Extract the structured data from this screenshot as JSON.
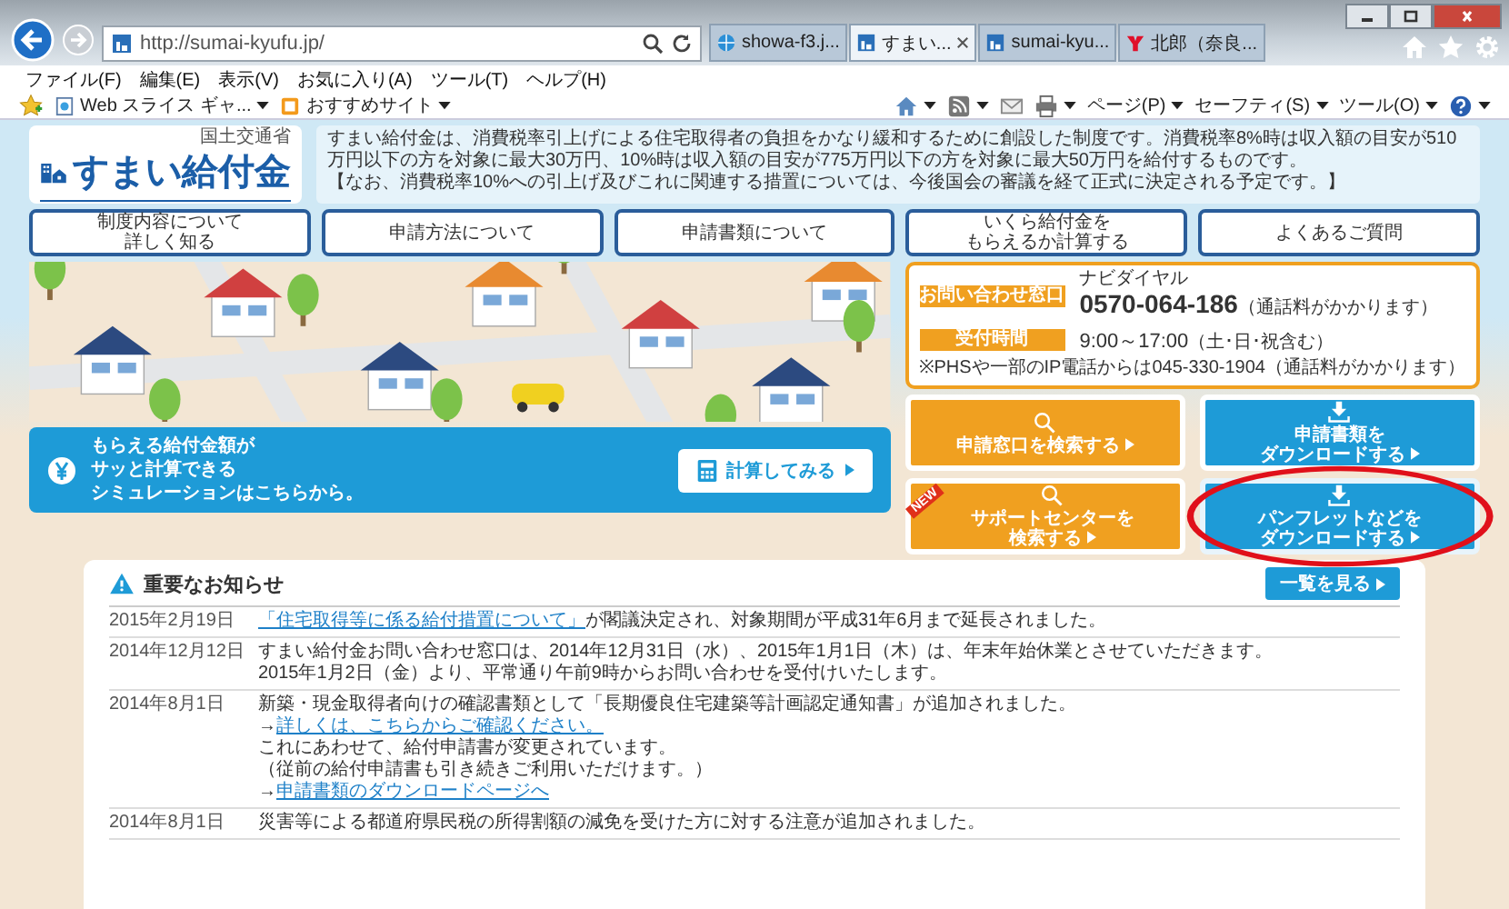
{
  "browser": {
    "url": "http://sumai-kyufu.jp/",
    "tabs": [
      {
        "label": "showa-f3.j...",
        "kind": "ie",
        "selected": false
      },
      {
        "label": "すまい...",
        "kind": "site",
        "selected": true
      },
      {
        "label": "sumai-kyu...",
        "kind": "site",
        "selected": false
      },
      {
        "label": "北郎（奈良...",
        "kind": "yahoo",
        "selected": false
      }
    ],
    "menu": [
      "ファイル(F)",
      "編集(E)",
      "表示(V)",
      "お気に入り(A)",
      "ツール(T)",
      "ヘルプ(H)"
    ],
    "favorites": [
      {
        "label": "Web スライス ギャ...",
        "kind": "webslice"
      },
      {
        "label": "おすすめサイト",
        "kind": "suggested"
      }
    ],
    "commands": [
      {
        "kind": "home"
      },
      {
        "kind": "feed"
      },
      {
        "kind": "mail"
      },
      {
        "kind": "print"
      },
      {
        "kind": "text",
        "label": "ページ(P)"
      },
      {
        "kind": "text",
        "label": "セーフティ(S)"
      },
      {
        "kind": "text",
        "label": "ツール(O)"
      },
      {
        "kind": "help"
      }
    ]
  },
  "page": {
    "logo": {
      "agency": "国土交通省",
      "title": "すまい給付金"
    },
    "description": [
      "すまい給付金は、消費税率引上げによる住宅取得者の負担をかなり緩和するために創設した制度です。消費税率8%時は収入額の目安が510万円以下の方を対象に最大30万円、10%時は収入額の目安が775万円以下の方を対象に最大50万円を給付するものです。",
      "【なお、消費税率10%への引上げ及びこれに関連する措置については、今後国会の審議を経て正式に決定される予定です。】"
    ],
    "nav": [
      {
        "lines": [
          "制度内容について",
          "詳しく知る"
        ]
      },
      {
        "lines": [
          "申請方法について"
        ]
      },
      {
        "lines": [
          "申請書類について"
        ]
      },
      {
        "lines": [
          "いくら給付金を",
          "もらえるか計算する"
        ]
      },
      {
        "lines": [
          "よくあるご質問"
        ]
      }
    ],
    "contact": {
      "label": "お問い合わせ窓口",
      "dial_label": "ナビダイヤル",
      "phone": "0570-064-186",
      "phone_note": "（通話料がかかります）",
      "hours_label": "受付時間",
      "hours": "9:00～17:00",
      "hours_note": "（土･日･祝含む）",
      "footnote": "※PHSや一部のIP電話からは045-330-1904（通話料がかかります）"
    },
    "actions": [
      {
        "kind": "search",
        "lines": [
          "申請窓口を検索する"
        ],
        "new": false,
        "circled": false
      },
      {
        "kind": "download",
        "lines": [
          "申請書類を",
          "ダウンロードする"
        ],
        "new": false,
        "circled": false
      },
      {
        "kind": "search",
        "lines": [
          "サポートセンターを",
          "検索する"
        ],
        "new": true,
        "new_label": "NEW",
        "circled": false
      },
      {
        "kind": "download",
        "lines": [
          "パンフレットなどを",
          "ダウンロードする"
        ],
        "new": false,
        "circled": true
      }
    ],
    "simulation": {
      "lines": [
        "もらえる給付金額が",
        "サッと計算できる",
        "シミュレーションはこちらから。"
      ],
      "button": "計算してみる"
    },
    "news": {
      "title": "重要なお知らせ",
      "button": "一覧を見る",
      "items": [
        {
          "date": "2015年2月19日",
          "lines": [
            [
              {
                "text": "「住宅取得等に係る給付措置について」",
                "link": true
              },
              {
                "text": "が閣議決定され、対象期間が平成31年6月まで延長されました。",
                "link": false
              }
            ]
          ]
        },
        {
          "date": "2014年12月12日",
          "lines": [
            [
              {
                "text": "すまい給付金お問い合わせ窓口は、2014年12月31日（水）、2015年1月1日（木）は、年末年始休業とさせていただきます。",
                "link": false
              }
            ],
            [
              {
                "text": "2015年1月2日（金）より、平常通り午前9時からお問い合わせを受付けいたします。",
                "link": false
              }
            ]
          ]
        },
        {
          "date": "2014年8月1日",
          "lines": [
            [
              {
                "text": "新築・現金取得者向けの確認書類として「長期優良住宅建築等計画認定通知書」が追加されました。",
                "link": false
              }
            ],
            [
              {
                "text": "→",
                "link": false
              },
              {
                "text": "詳しくは、こちらからご確認ください。",
                "link": true
              }
            ],
            [
              {
                "text": "これにあわせて、給付申請書が変更されています。",
                "link": false
              }
            ],
            [
              {
                "text": "（従前の給付申請書も引き続きご利用いただけます。）",
                "link": false
              }
            ],
            [
              {
                "text": "→",
                "link": false
              },
              {
                "text": "申請書類のダウンロードページへ",
                "link": true
              }
            ]
          ]
        },
        {
          "date": "2014年8月1日",
          "lines": [
            [
              {
                "text": "災害等による都道府県民税の所得割額の減免を受けた方に対する注意が追加されました。",
                "link": false
              }
            ]
          ]
        }
      ]
    }
  }
}
